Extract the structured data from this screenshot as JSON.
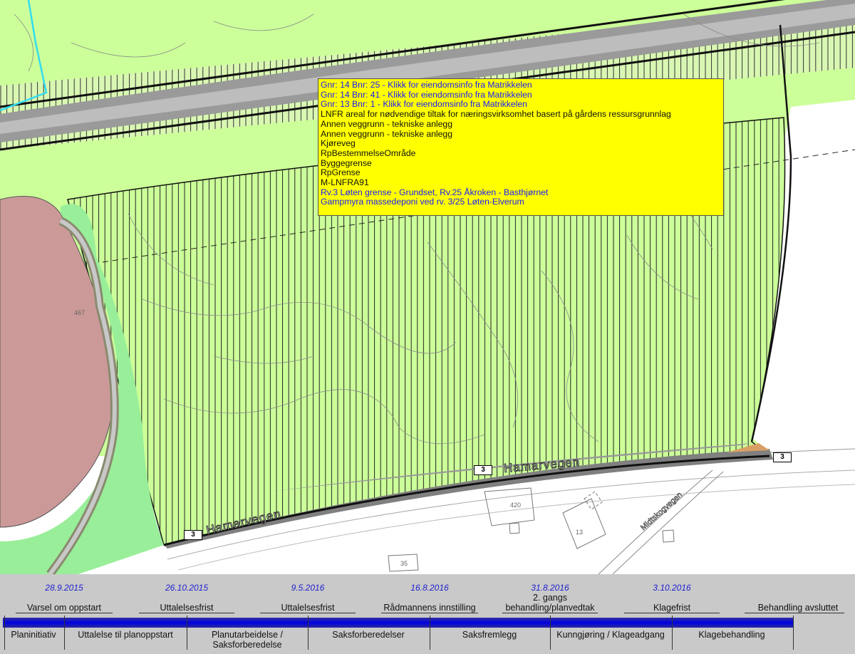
{
  "popup": {
    "lines": [
      {
        "text": "Gnr: 14 Bnr: 25 - Klikk for eiendomsinfo fra Matrikkelen",
        "link": true
      },
      {
        "text": "Gnr: 14 Bnr: 41 - Klikk for eiendomsinfo fra Matrikkelen",
        "link": true
      },
      {
        "text": "Gnr: 13 Bnr: 1 - Klikk for eiendomsinfo fra Matrikkelen",
        "link": true
      },
      {
        "text": "LNFR areal for nødvendige tiltak for næringsvirksomhet basert på gårdens ressursgrunnlag",
        "link": false
      },
      {
        "text": "Annen veggrunn - tekniske anlegg",
        "link": false
      },
      {
        "text": "Annen veggrunn - tekniske anlegg",
        "link": false
      },
      {
        "text": "Kjøreveg",
        "link": false
      },
      {
        "text": "RpBestemmelseOmråde",
        "link": false
      },
      {
        "text": "Byggegrense",
        "link": false
      },
      {
        "text": "RpGrense",
        "link": false
      },
      {
        "text": "M-LNFRA91",
        "link": false
      },
      {
        "text": "Rv.3 Løten grense - Grundset, Rv.25 Åkroken - Basthjørnet",
        "link": true
      },
      {
        "text": "Gampmyra massedeponi ved rv. 3/25 Løten-Elverum",
        "link": true
      }
    ]
  },
  "map": {
    "road_number": "3",
    "road_name": "Hamarvegen",
    "side_road_name": "Midtskogvegen",
    "building_labels": {
      "a": "420",
      "b": "13",
      "c": "35",
      "d": "467"
    },
    "colors": {
      "lnf": "#ccff99",
      "lnf_light": "#e6f5d0",
      "green": "#99ee99",
      "pink": "#cc9999",
      "road": "#808080",
      "hatch": "#222222"
    }
  },
  "timeline": {
    "dates": [
      "28.9.2015",
      "26.10.2015",
      "9.5.2016",
      "16.8.2016",
      "31.8.2016",
      "3.10.2016"
    ],
    "milestones": [
      "Varsel om oppstart",
      "Uttalelsesfrist",
      "Uttalelsesfrist",
      "Rådmannens innstilling",
      "2. gangs behandling/planvedtak",
      "Klagefrist",
      "Behandling avsluttet"
    ],
    "milestone_lines": [
      [
        "2. gangs",
        "behandling/planvedtak"
      ]
    ],
    "phases": [
      "Planinitiativ",
      "Uttalelse til planoppstart",
      "Planutarbeidelse /",
      "Saksforberedelse",
      "Saksforberedelser",
      "Saksfremlegg",
      "Kunngjøring / Klageadgang",
      "Klagebehandling"
    ]
  }
}
